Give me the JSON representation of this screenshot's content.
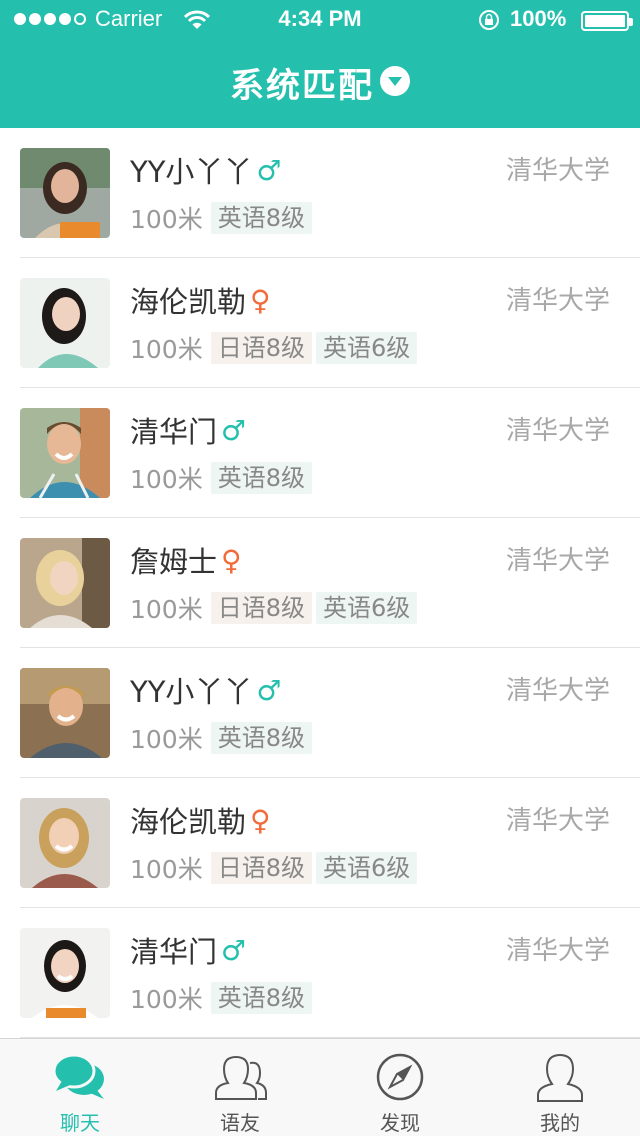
{
  "status_bar": {
    "carrier": "Carrier",
    "time": "4:34 PM",
    "battery": "100%"
  },
  "header": {
    "title": "系统匹配",
    "background": "#25bfae"
  },
  "users": [
    {
      "name": "YY小丫丫",
      "gender": "♂",
      "gender_type": "male",
      "school": "清华大学",
      "distance": "100米",
      "tags": [
        "英语8级"
      ]
    },
    {
      "name": "海伦凯勒",
      "gender": "♀",
      "gender_type": "female",
      "school": "清华大学",
      "distance": "100米",
      "tags": [
        "日语8级",
        "英语6级"
      ]
    },
    {
      "name": "清华门",
      "gender": "♂",
      "gender_type": "male",
      "school": "清华大学",
      "distance": "100米",
      "tags": [
        "英语8级"
      ]
    },
    {
      "name": "詹姆士",
      "gender": "♀",
      "gender_type": "female",
      "school": "清华大学",
      "distance": "100米",
      "tags": [
        "日语8级",
        "英语6级"
      ]
    },
    {
      "name": "YY小丫丫",
      "gender": "♂",
      "gender_type": "male",
      "school": "清华大学",
      "distance": "100米",
      "tags": [
        "英语8级"
      ]
    },
    {
      "name": "海伦凯勒",
      "gender": "♀",
      "gender_type": "female",
      "school": "清华大学",
      "distance": "100米",
      "tags": [
        "日语8级",
        "英语6级"
      ]
    },
    {
      "name": "清华门",
      "gender": "♂",
      "gender_type": "male",
      "school": "清华大学",
      "distance": "100米",
      "tags": [
        "英语8级"
      ]
    }
  ],
  "tabs": [
    {
      "label": "聊天",
      "icon": "chat-bubbles-icon",
      "active": true
    },
    {
      "label": "语友",
      "icon": "friends-icon",
      "active": false
    },
    {
      "label": "发现",
      "icon": "compass-icon",
      "active": false
    },
    {
      "label": "我的",
      "icon": "profile-icon",
      "active": false
    }
  ],
  "colors": {
    "accent": "#25bfae",
    "female": "#f26b3a",
    "school_text": "#a8a8a8"
  }
}
